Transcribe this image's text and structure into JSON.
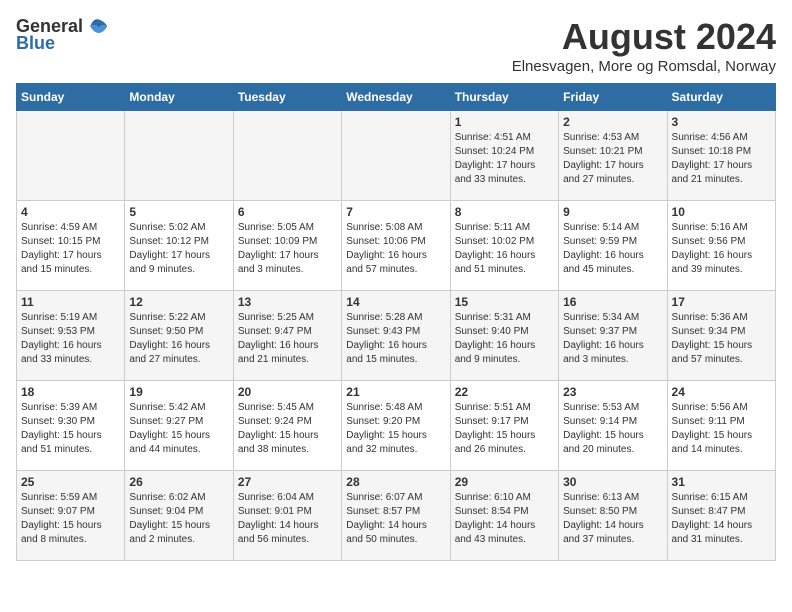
{
  "header": {
    "logo_general": "General",
    "logo_blue": "Blue",
    "month": "August 2024",
    "location": "Elnesvagen, More og Romsdal, Norway"
  },
  "weekdays": [
    "Sunday",
    "Monday",
    "Tuesday",
    "Wednesday",
    "Thursday",
    "Friday",
    "Saturday"
  ],
  "weeks": [
    [
      {
        "day": "",
        "info": ""
      },
      {
        "day": "",
        "info": ""
      },
      {
        "day": "",
        "info": ""
      },
      {
        "day": "",
        "info": ""
      },
      {
        "day": "1",
        "info": "Sunrise: 4:51 AM\nSunset: 10:24 PM\nDaylight: 17 hours\nand 33 minutes."
      },
      {
        "day": "2",
        "info": "Sunrise: 4:53 AM\nSunset: 10:21 PM\nDaylight: 17 hours\nand 27 minutes."
      },
      {
        "day": "3",
        "info": "Sunrise: 4:56 AM\nSunset: 10:18 PM\nDaylight: 17 hours\nand 21 minutes."
      }
    ],
    [
      {
        "day": "4",
        "info": "Sunrise: 4:59 AM\nSunset: 10:15 PM\nDaylight: 17 hours\nand 15 minutes."
      },
      {
        "day": "5",
        "info": "Sunrise: 5:02 AM\nSunset: 10:12 PM\nDaylight: 17 hours\nand 9 minutes."
      },
      {
        "day": "6",
        "info": "Sunrise: 5:05 AM\nSunset: 10:09 PM\nDaylight: 17 hours\nand 3 minutes."
      },
      {
        "day": "7",
        "info": "Sunrise: 5:08 AM\nSunset: 10:06 PM\nDaylight: 16 hours\nand 57 minutes."
      },
      {
        "day": "8",
        "info": "Sunrise: 5:11 AM\nSunset: 10:02 PM\nDaylight: 16 hours\nand 51 minutes."
      },
      {
        "day": "9",
        "info": "Sunrise: 5:14 AM\nSunset: 9:59 PM\nDaylight: 16 hours\nand 45 minutes."
      },
      {
        "day": "10",
        "info": "Sunrise: 5:16 AM\nSunset: 9:56 PM\nDaylight: 16 hours\nand 39 minutes."
      }
    ],
    [
      {
        "day": "11",
        "info": "Sunrise: 5:19 AM\nSunset: 9:53 PM\nDaylight: 16 hours\nand 33 minutes."
      },
      {
        "day": "12",
        "info": "Sunrise: 5:22 AM\nSunset: 9:50 PM\nDaylight: 16 hours\nand 27 minutes."
      },
      {
        "day": "13",
        "info": "Sunrise: 5:25 AM\nSunset: 9:47 PM\nDaylight: 16 hours\nand 21 minutes."
      },
      {
        "day": "14",
        "info": "Sunrise: 5:28 AM\nSunset: 9:43 PM\nDaylight: 16 hours\nand 15 minutes."
      },
      {
        "day": "15",
        "info": "Sunrise: 5:31 AM\nSunset: 9:40 PM\nDaylight: 16 hours\nand 9 minutes."
      },
      {
        "day": "16",
        "info": "Sunrise: 5:34 AM\nSunset: 9:37 PM\nDaylight: 16 hours\nand 3 minutes."
      },
      {
        "day": "17",
        "info": "Sunrise: 5:36 AM\nSunset: 9:34 PM\nDaylight: 15 hours\nand 57 minutes."
      }
    ],
    [
      {
        "day": "18",
        "info": "Sunrise: 5:39 AM\nSunset: 9:30 PM\nDaylight: 15 hours\nand 51 minutes."
      },
      {
        "day": "19",
        "info": "Sunrise: 5:42 AM\nSunset: 9:27 PM\nDaylight: 15 hours\nand 44 minutes."
      },
      {
        "day": "20",
        "info": "Sunrise: 5:45 AM\nSunset: 9:24 PM\nDaylight: 15 hours\nand 38 minutes."
      },
      {
        "day": "21",
        "info": "Sunrise: 5:48 AM\nSunset: 9:20 PM\nDaylight: 15 hours\nand 32 minutes."
      },
      {
        "day": "22",
        "info": "Sunrise: 5:51 AM\nSunset: 9:17 PM\nDaylight: 15 hours\nand 26 minutes."
      },
      {
        "day": "23",
        "info": "Sunrise: 5:53 AM\nSunset: 9:14 PM\nDaylight: 15 hours\nand 20 minutes."
      },
      {
        "day": "24",
        "info": "Sunrise: 5:56 AM\nSunset: 9:11 PM\nDaylight: 15 hours\nand 14 minutes."
      }
    ],
    [
      {
        "day": "25",
        "info": "Sunrise: 5:59 AM\nSunset: 9:07 PM\nDaylight: 15 hours\nand 8 minutes."
      },
      {
        "day": "26",
        "info": "Sunrise: 6:02 AM\nSunset: 9:04 PM\nDaylight: 15 hours\nand 2 minutes."
      },
      {
        "day": "27",
        "info": "Sunrise: 6:04 AM\nSunset: 9:01 PM\nDaylight: 14 hours\nand 56 minutes."
      },
      {
        "day": "28",
        "info": "Sunrise: 6:07 AM\nSunset: 8:57 PM\nDaylight: 14 hours\nand 50 minutes."
      },
      {
        "day": "29",
        "info": "Sunrise: 6:10 AM\nSunset: 8:54 PM\nDaylight: 14 hours\nand 43 minutes."
      },
      {
        "day": "30",
        "info": "Sunrise: 6:13 AM\nSunset: 8:50 PM\nDaylight: 14 hours\nand 37 minutes."
      },
      {
        "day": "31",
        "info": "Sunrise: 6:15 AM\nSunset: 8:47 PM\nDaylight: 14 hours\nand 31 minutes."
      }
    ]
  ]
}
